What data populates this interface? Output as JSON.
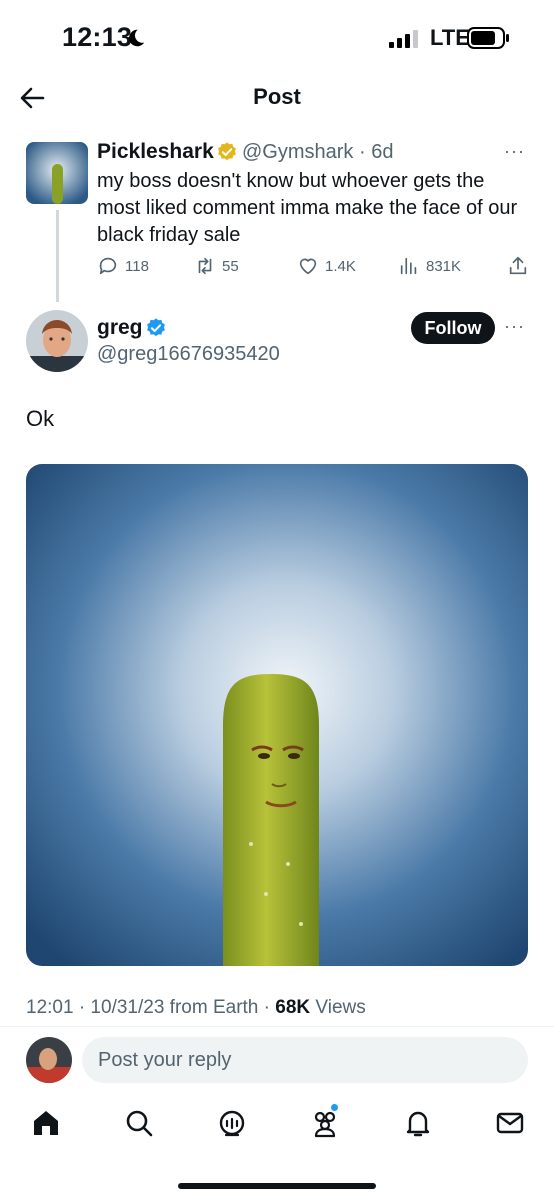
{
  "status_bar": {
    "time": "12:13",
    "network": "LTE"
  },
  "header": {
    "title": "Post"
  },
  "parent_tweet": {
    "name": "Pickleshark",
    "handle_time": "@Gymshark · 6d",
    "more": "···",
    "text": "my boss doesn't know but whoever gets the most liked comment imma make the face of our black friday sale",
    "replies": "118",
    "retweets": "55",
    "likes": "1.4K",
    "views": "831K"
  },
  "main_tweet": {
    "name": "greg",
    "handle": "@greg16676935420",
    "follow_label": "Follow",
    "more": "···",
    "text": "Ok",
    "meta_time": "12:01 · 10/31/23 from Earth · ",
    "meta_views_count": "68K",
    "meta_views_label": " Views"
  },
  "reply": {
    "placeholder": "Post your reply"
  },
  "nav": {
    "items": [
      "home-icon",
      "search-icon",
      "grok-icon",
      "communities-icon",
      "notifications-icon",
      "messages-icon"
    ]
  },
  "colors": {
    "verified_gold": "#e2b719",
    "verified_blue": "#1d9bf0",
    "text_secondary": "#536471",
    "accent_dot": "#1d9bf0"
  }
}
